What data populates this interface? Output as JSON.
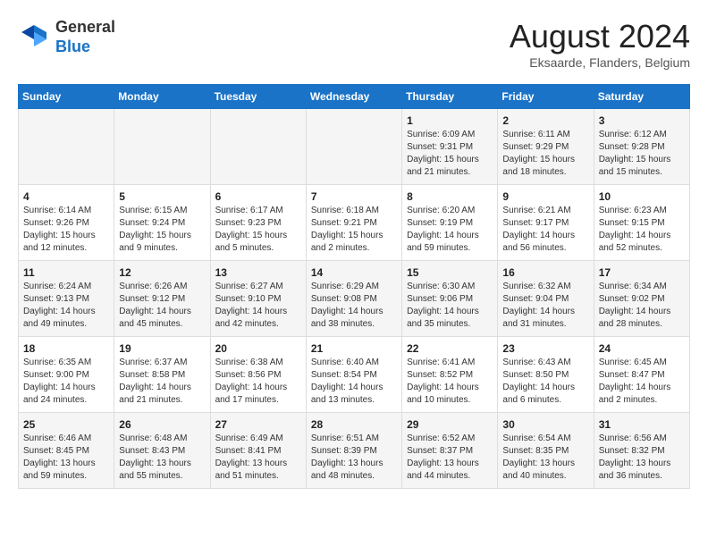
{
  "header": {
    "logo_line1": "General",
    "logo_line2": "Blue",
    "month_title": "August 2024",
    "subtitle": "Eksaarde, Flanders, Belgium"
  },
  "days_of_week": [
    "Sunday",
    "Monday",
    "Tuesday",
    "Wednesday",
    "Thursday",
    "Friday",
    "Saturday"
  ],
  "weeks": [
    [
      {
        "day": "",
        "info": ""
      },
      {
        "day": "",
        "info": ""
      },
      {
        "day": "",
        "info": ""
      },
      {
        "day": "",
        "info": ""
      },
      {
        "day": "1",
        "info": "Sunrise: 6:09 AM\nSunset: 9:31 PM\nDaylight: 15 hours\nand 21 minutes."
      },
      {
        "day": "2",
        "info": "Sunrise: 6:11 AM\nSunset: 9:29 PM\nDaylight: 15 hours\nand 18 minutes."
      },
      {
        "day": "3",
        "info": "Sunrise: 6:12 AM\nSunset: 9:28 PM\nDaylight: 15 hours\nand 15 minutes."
      }
    ],
    [
      {
        "day": "4",
        "info": "Sunrise: 6:14 AM\nSunset: 9:26 PM\nDaylight: 15 hours\nand 12 minutes."
      },
      {
        "day": "5",
        "info": "Sunrise: 6:15 AM\nSunset: 9:24 PM\nDaylight: 15 hours\nand 9 minutes."
      },
      {
        "day": "6",
        "info": "Sunrise: 6:17 AM\nSunset: 9:23 PM\nDaylight: 15 hours\nand 5 minutes."
      },
      {
        "day": "7",
        "info": "Sunrise: 6:18 AM\nSunset: 9:21 PM\nDaylight: 15 hours\nand 2 minutes."
      },
      {
        "day": "8",
        "info": "Sunrise: 6:20 AM\nSunset: 9:19 PM\nDaylight: 14 hours\nand 59 minutes."
      },
      {
        "day": "9",
        "info": "Sunrise: 6:21 AM\nSunset: 9:17 PM\nDaylight: 14 hours\nand 56 minutes."
      },
      {
        "day": "10",
        "info": "Sunrise: 6:23 AM\nSunset: 9:15 PM\nDaylight: 14 hours\nand 52 minutes."
      }
    ],
    [
      {
        "day": "11",
        "info": "Sunrise: 6:24 AM\nSunset: 9:13 PM\nDaylight: 14 hours\nand 49 minutes."
      },
      {
        "day": "12",
        "info": "Sunrise: 6:26 AM\nSunset: 9:12 PM\nDaylight: 14 hours\nand 45 minutes."
      },
      {
        "day": "13",
        "info": "Sunrise: 6:27 AM\nSunset: 9:10 PM\nDaylight: 14 hours\nand 42 minutes."
      },
      {
        "day": "14",
        "info": "Sunrise: 6:29 AM\nSunset: 9:08 PM\nDaylight: 14 hours\nand 38 minutes."
      },
      {
        "day": "15",
        "info": "Sunrise: 6:30 AM\nSunset: 9:06 PM\nDaylight: 14 hours\nand 35 minutes."
      },
      {
        "day": "16",
        "info": "Sunrise: 6:32 AM\nSunset: 9:04 PM\nDaylight: 14 hours\nand 31 minutes."
      },
      {
        "day": "17",
        "info": "Sunrise: 6:34 AM\nSunset: 9:02 PM\nDaylight: 14 hours\nand 28 minutes."
      }
    ],
    [
      {
        "day": "18",
        "info": "Sunrise: 6:35 AM\nSunset: 9:00 PM\nDaylight: 14 hours\nand 24 minutes."
      },
      {
        "day": "19",
        "info": "Sunrise: 6:37 AM\nSunset: 8:58 PM\nDaylight: 14 hours\nand 21 minutes."
      },
      {
        "day": "20",
        "info": "Sunrise: 6:38 AM\nSunset: 8:56 PM\nDaylight: 14 hours\nand 17 minutes."
      },
      {
        "day": "21",
        "info": "Sunrise: 6:40 AM\nSunset: 8:54 PM\nDaylight: 14 hours\nand 13 minutes."
      },
      {
        "day": "22",
        "info": "Sunrise: 6:41 AM\nSunset: 8:52 PM\nDaylight: 14 hours\nand 10 minutes."
      },
      {
        "day": "23",
        "info": "Sunrise: 6:43 AM\nSunset: 8:50 PM\nDaylight: 14 hours\nand 6 minutes."
      },
      {
        "day": "24",
        "info": "Sunrise: 6:45 AM\nSunset: 8:47 PM\nDaylight: 14 hours\nand 2 minutes."
      }
    ],
    [
      {
        "day": "25",
        "info": "Sunrise: 6:46 AM\nSunset: 8:45 PM\nDaylight: 13 hours\nand 59 minutes."
      },
      {
        "day": "26",
        "info": "Sunrise: 6:48 AM\nSunset: 8:43 PM\nDaylight: 13 hours\nand 55 minutes."
      },
      {
        "day": "27",
        "info": "Sunrise: 6:49 AM\nSunset: 8:41 PM\nDaylight: 13 hours\nand 51 minutes."
      },
      {
        "day": "28",
        "info": "Sunrise: 6:51 AM\nSunset: 8:39 PM\nDaylight: 13 hours\nand 48 minutes."
      },
      {
        "day": "29",
        "info": "Sunrise: 6:52 AM\nSunset: 8:37 PM\nDaylight: 13 hours\nand 44 minutes."
      },
      {
        "day": "30",
        "info": "Sunrise: 6:54 AM\nSunset: 8:35 PM\nDaylight: 13 hours\nand 40 minutes."
      },
      {
        "day": "31",
        "info": "Sunrise: 6:56 AM\nSunset: 8:32 PM\nDaylight: 13 hours\nand 36 minutes."
      }
    ]
  ]
}
